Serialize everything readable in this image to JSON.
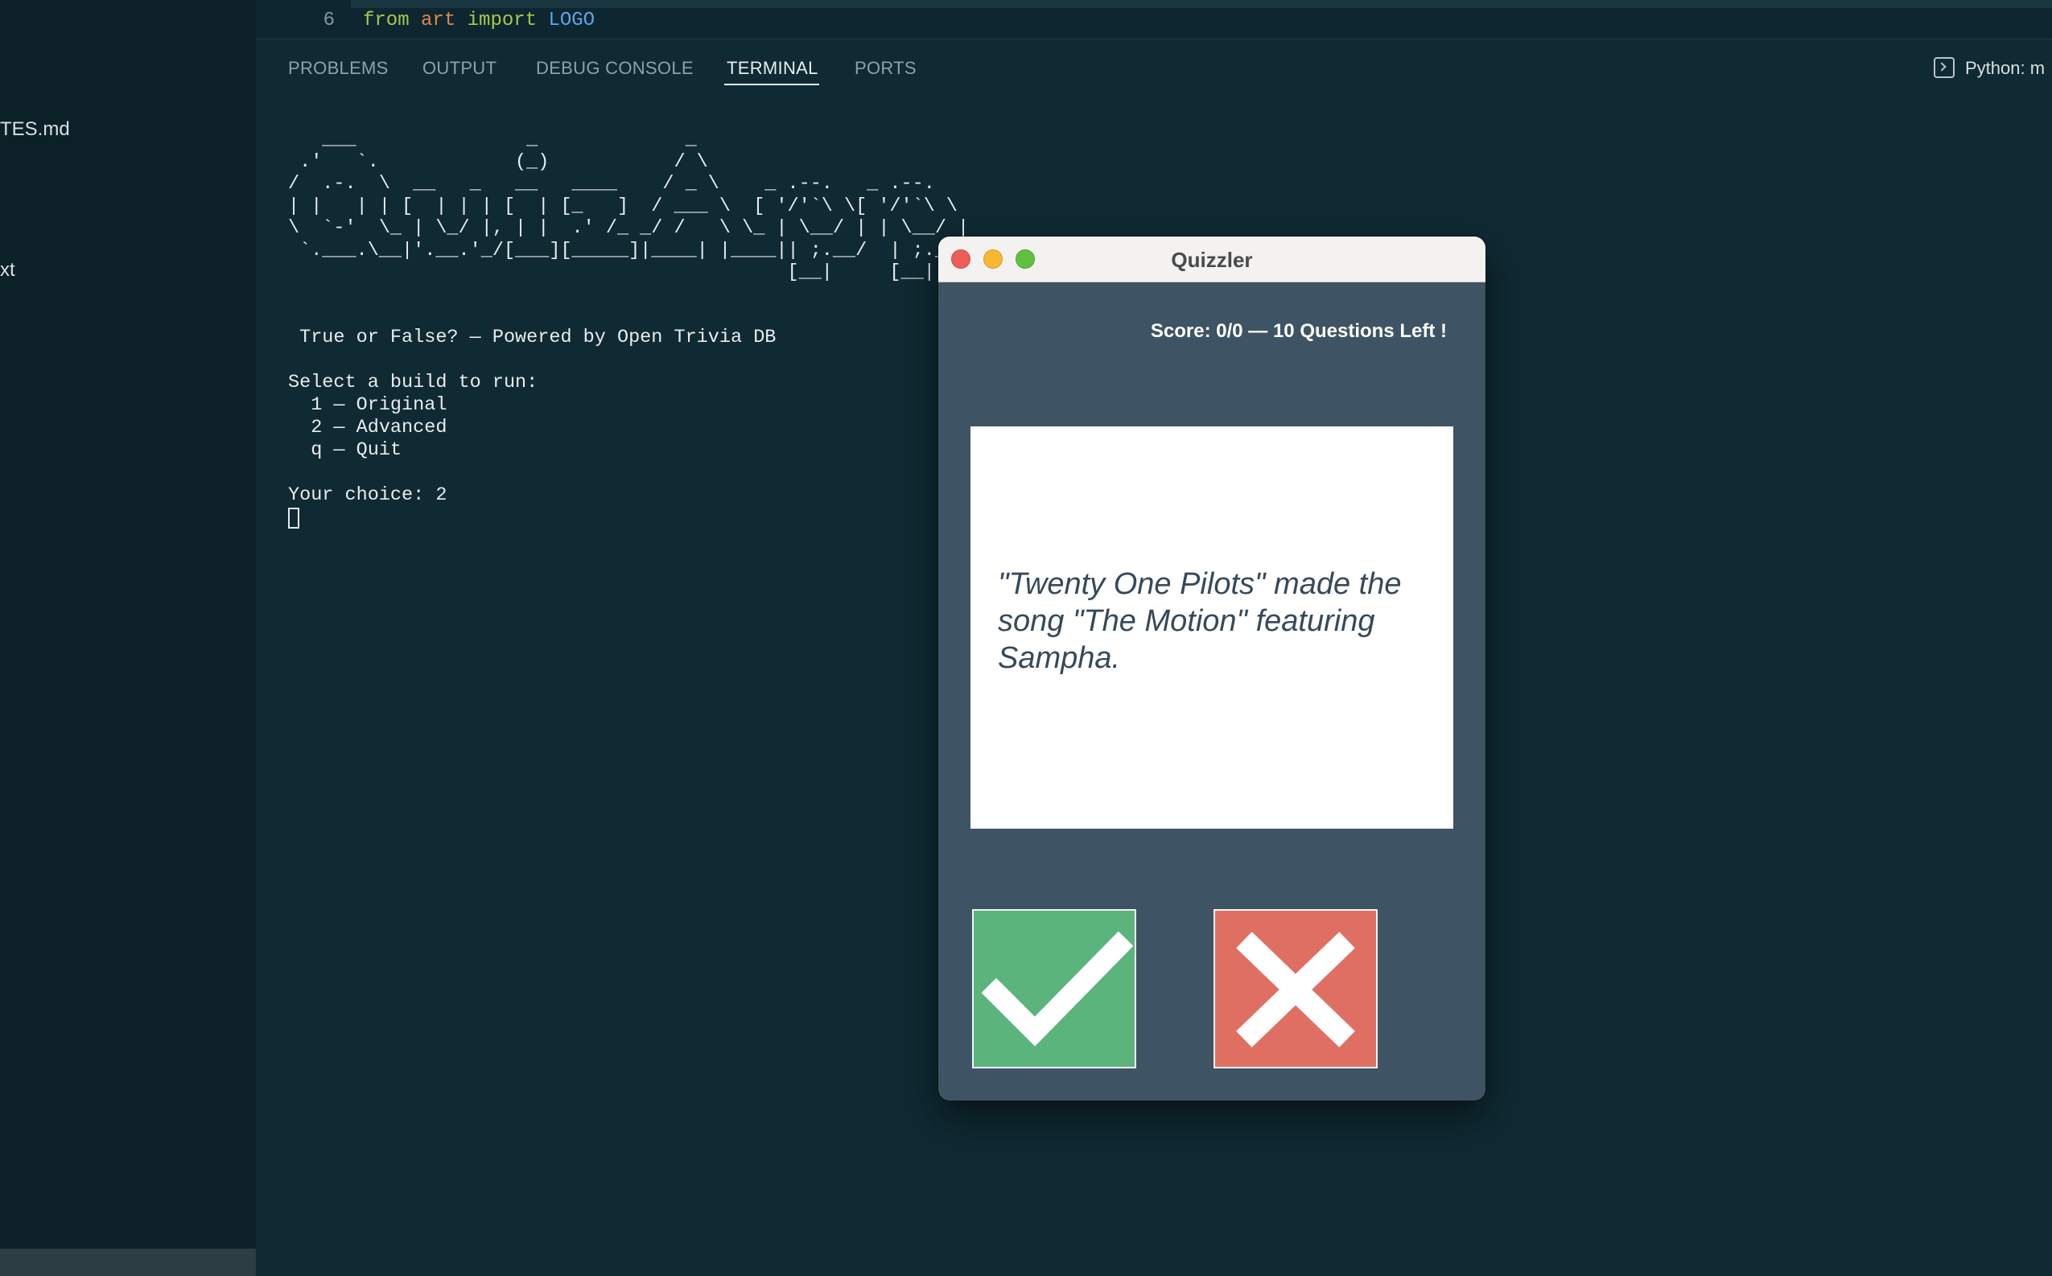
{
  "sidebar": {
    "files": [
      {
        "label": "TES.md"
      },
      {
        "label": "xt"
      }
    ]
  },
  "editor": {
    "line_number": "6",
    "code": {
      "kw_from": "from",
      "module": "art",
      "kw_import": "import",
      "name": "LOGO"
    }
  },
  "panel": {
    "tabs": [
      {
        "label": "PROBLEMS",
        "active": false
      },
      {
        "label": "OUTPUT",
        "active": false
      },
      {
        "label": "DEBUG CONSOLE",
        "active": false
      },
      {
        "label": "TERMINAL",
        "active": true
      },
      {
        "label": "PORTS",
        "active": false
      }
    ],
    "terminal_profile": "Python: m"
  },
  "terminal": {
    "ascii_logo": "   ___               _             _\n .'   `.            (_)           / \\\n/  .-.  \\  __   _   __   ____    / _ \\    _ .--.   _ .--.\n| |   | | [  | | | [  | [_   ]  / ___ \\  [ '/'`\\ \\[ '/'`\\ \\\n\\  `-'  \\_ | \\_/ |, | |  .' /_ _/ /   \\ \\_ | \\__/ | | \\__/ |\n `.___.\\__|'.__.'_/[___][_____]|____| |____|| ;.__/  | ;.__/\n                                            [__|     [__|",
    "subtitle": " True or False? — Powered by Open Trivia DB",
    "menu_prompt": "Select a build to run:",
    "menu_options": [
      "  1 — Original",
      "  2 — Advanced",
      "  q — Quit"
    ],
    "choice_line": "Your choice: 2"
  },
  "quiz_window": {
    "title": "Quizzler",
    "score_text": "Score: 0/0 — 10 Questions Left !",
    "question": "\"Twenty One Pilots\" made the song \"The Motion\" featuring Sampha.",
    "true_button_icon": "check-icon",
    "false_button_icon": "cross-icon",
    "colors": {
      "window_bg": "#3e5363",
      "true_button": "#5bb47c",
      "false_button": "#e06f63",
      "question_text": "#36495a"
    }
  }
}
